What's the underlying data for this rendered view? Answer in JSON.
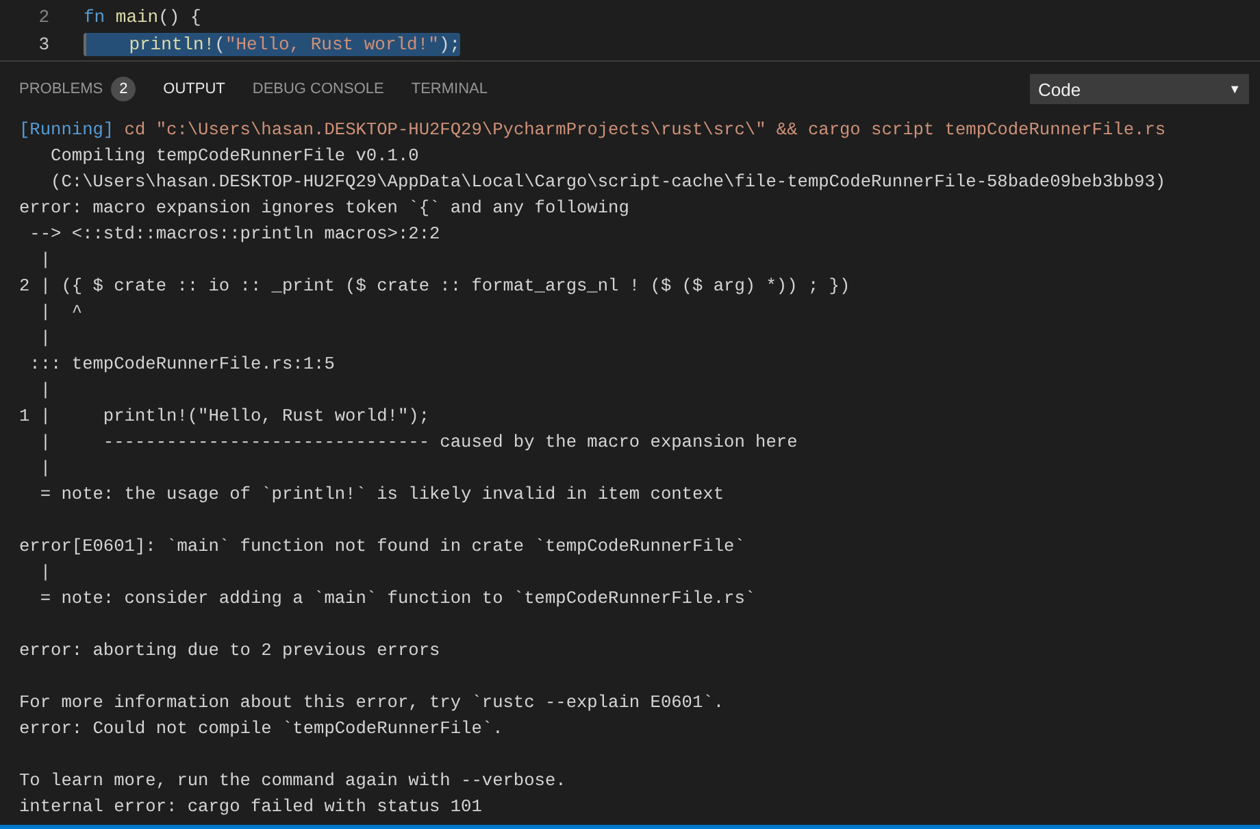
{
  "editor": {
    "lines": [
      {
        "number": "2",
        "selected": false,
        "tokens": [
          {
            "kind": "keyword",
            "text": "fn"
          },
          {
            "kind": "function",
            "text": "main"
          },
          {
            "kind": "plain",
            "text": "() {"
          }
        ],
        "children": [
          {
            "number": "3",
            "selected": true,
            "tokens": [
              {
                "kind": "function",
                "text": "println!"
              },
              {
                "kind": "plain",
                "text": "("
              },
              {
                "kind": "string",
                "text": "\"Hello, Rust world!\""
              },
              {
                "kind": "plain",
                "text": ");"
              }
            ]
          }
        ]
      }
    ]
  },
  "panel": {
    "tabs": [
      {
        "label": "PROBLEMS",
        "badge": "2",
        "selected": false
      },
      {
        "label": "OUTPUT",
        "selected": true
      },
      {
        "label": "DEBUG CONSOLE",
        "selected": false
      },
      {
        "label": "TERMINAL",
        "selected": false
      }
    ],
    "channel_select": {
      "value": "Code",
      "arrow": "▼"
    },
    "output": [
      {
        "kind": "running",
        "tag": "[Running]",
        "text": " cd \"c:\\Users\\hasan.DESKTOP-HU2FQ29\\PycharmProjects\\rust\\src\\\" && cargo script tempCodeRunnerFile.rs"
      },
      {
        "kind": "plain",
        "text": "   Compiling tempCodeRunnerFile v0.1.0"
      },
      {
        "kind": "plain",
        "text": "   (C:\\Users\\hasan.DESKTOP-HU2FQ29\\AppData\\Local\\Cargo\\script-cache\\file-tempCodeRunnerFile-58bade09beb3bb93)"
      },
      {
        "kind": "plain",
        "text": "error: macro expansion ignores token `{` and any following"
      },
      {
        "kind": "plain",
        "text": " --> <::std::macros::println macros>:2:2"
      },
      {
        "kind": "plain",
        "text": "  |"
      },
      {
        "kind": "plain",
        "text": "2 | ({ $ crate :: io :: _print ($ crate :: format_args_nl ! ($ ($ arg) *)) ; })"
      },
      {
        "kind": "plain",
        "text": "  |  ^"
      },
      {
        "kind": "plain",
        "text": "  |"
      },
      {
        "kind": "plain",
        "text": " ::: tempCodeRunnerFile.rs:1:5"
      },
      {
        "kind": "plain",
        "text": "  |"
      },
      {
        "kind": "plain",
        "text": "1 |     println!(\"Hello, Rust world!\");"
      },
      {
        "kind": "plain",
        "text": "  |     ------------------------------- caused by the macro expansion here"
      },
      {
        "kind": "plain",
        "text": "  |"
      },
      {
        "kind": "plain",
        "text": "  = note: the usage of `println!` is likely invalid in item context"
      },
      {
        "kind": "plain",
        "gap_before": true,
        "text": "error[E0601]: `main` function not found in crate `tempCodeRunnerFile`"
      },
      {
        "kind": "plain",
        "text": "  |"
      },
      {
        "kind": "plain",
        "text": "  = note: consider adding a `main` function to `tempCodeRunnerFile.rs`"
      },
      {
        "kind": "plain",
        "gap_before": true,
        "text": "error: aborting due to 2 previous errors"
      },
      {
        "kind": "plain",
        "gap_before": true,
        "text": "For more information about this error, try `rustc --explain E0601`."
      },
      {
        "kind": "plain",
        "text": "error: Could not compile `tempCodeRunnerFile`."
      },
      {
        "kind": "plain",
        "gap_before": true,
        "text": "To learn more, run the command again with --verbose."
      },
      {
        "kind": "plain",
        "text": "internal error: cargo failed with status 101"
      }
    ]
  }
}
